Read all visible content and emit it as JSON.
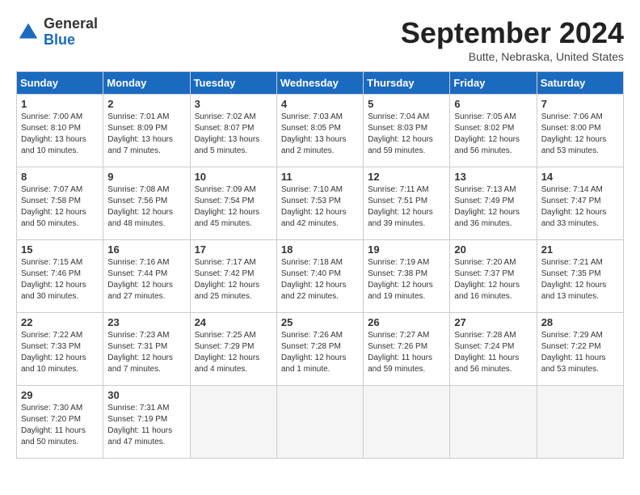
{
  "logo": {
    "general": "General",
    "blue": "Blue"
  },
  "header": {
    "month": "September 2024",
    "location": "Butte, Nebraska, United States"
  },
  "weekdays": [
    "Sunday",
    "Monday",
    "Tuesday",
    "Wednesday",
    "Thursday",
    "Friday",
    "Saturday"
  ],
  "weeks": [
    [
      {
        "day": "1",
        "sunrise": "Sunrise: 7:00 AM",
        "sunset": "Sunset: 8:10 PM",
        "daylight": "Daylight: 13 hours and 10 minutes."
      },
      {
        "day": "2",
        "sunrise": "Sunrise: 7:01 AM",
        "sunset": "Sunset: 8:09 PM",
        "daylight": "Daylight: 13 hours and 7 minutes."
      },
      {
        "day": "3",
        "sunrise": "Sunrise: 7:02 AM",
        "sunset": "Sunset: 8:07 PM",
        "daylight": "Daylight: 13 hours and 5 minutes."
      },
      {
        "day": "4",
        "sunrise": "Sunrise: 7:03 AM",
        "sunset": "Sunset: 8:05 PM",
        "daylight": "Daylight: 13 hours and 2 minutes."
      },
      {
        "day": "5",
        "sunrise": "Sunrise: 7:04 AM",
        "sunset": "Sunset: 8:03 PM",
        "daylight": "Daylight: 12 hours and 59 minutes."
      },
      {
        "day": "6",
        "sunrise": "Sunrise: 7:05 AM",
        "sunset": "Sunset: 8:02 PM",
        "daylight": "Daylight: 12 hours and 56 minutes."
      },
      {
        "day": "7",
        "sunrise": "Sunrise: 7:06 AM",
        "sunset": "Sunset: 8:00 PM",
        "daylight": "Daylight: 12 hours and 53 minutes."
      }
    ],
    [
      {
        "day": "8",
        "sunrise": "Sunrise: 7:07 AM",
        "sunset": "Sunset: 7:58 PM",
        "daylight": "Daylight: 12 hours and 50 minutes."
      },
      {
        "day": "9",
        "sunrise": "Sunrise: 7:08 AM",
        "sunset": "Sunset: 7:56 PM",
        "daylight": "Daylight: 12 hours and 48 minutes."
      },
      {
        "day": "10",
        "sunrise": "Sunrise: 7:09 AM",
        "sunset": "Sunset: 7:54 PM",
        "daylight": "Daylight: 12 hours and 45 minutes."
      },
      {
        "day": "11",
        "sunrise": "Sunrise: 7:10 AM",
        "sunset": "Sunset: 7:53 PM",
        "daylight": "Daylight: 12 hours and 42 minutes."
      },
      {
        "day": "12",
        "sunrise": "Sunrise: 7:11 AM",
        "sunset": "Sunset: 7:51 PM",
        "daylight": "Daylight: 12 hours and 39 minutes."
      },
      {
        "day": "13",
        "sunrise": "Sunrise: 7:13 AM",
        "sunset": "Sunset: 7:49 PM",
        "daylight": "Daylight: 12 hours and 36 minutes."
      },
      {
        "day": "14",
        "sunrise": "Sunrise: 7:14 AM",
        "sunset": "Sunset: 7:47 PM",
        "daylight": "Daylight: 12 hours and 33 minutes."
      }
    ],
    [
      {
        "day": "15",
        "sunrise": "Sunrise: 7:15 AM",
        "sunset": "Sunset: 7:46 PM",
        "daylight": "Daylight: 12 hours and 30 minutes."
      },
      {
        "day": "16",
        "sunrise": "Sunrise: 7:16 AM",
        "sunset": "Sunset: 7:44 PM",
        "daylight": "Daylight: 12 hours and 27 minutes."
      },
      {
        "day": "17",
        "sunrise": "Sunrise: 7:17 AM",
        "sunset": "Sunset: 7:42 PM",
        "daylight": "Daylight: 12 hours and 25 minutes."
      },
      {
        "day": "18",
        "sunrise": "Sunrise: 7:18 AM",
        "sunset": "Sunset: 7:40 PM",
        "daylight": "Daylight: 12 hours and 22 minutes."
      },
      {
        "day": "19",
        "sunrise": "Sunrise: 7:19 AM",
        "sunset": "Sunset: 7:38 PM",
        "daylight": "Daylight: 12 hours and 19 minutes."
      },
      {
        "day": "20",
        "sunrise": "Sunrise: 7:20 AM",
        "sunset": "Sunset: 7:37 PM",
        "daylight": "Daylight: 12 hours and 16 minutes."
      },
      {
        "day": "21",
        "sunrise": "Sunrise: 7:21 AM",
        "sunset": "Sunset: 7:35 PM",
        "daylight": "Daylight: 12 hours and 13 minutes."
      }
    ],
    [
      {
        "day": "22",
        "sunrise": "Sunrise: 7:22 AM",
        "sunset": "Sunset: 7:33 PM",
        "daylight": "Daylight: 12 hours and 10 minutes."
      },
      {
        "day": "23",
        "sunrise": "Sunrise: 7:23 AM",
        "sunset": "Sunset: 7:31 PM",
        "daylight": "Daylight: 12 hours and 7 minutes."
      },
      {
        "day": "24",
        "sunrise": "Sunrise: 7:25 AM",
        "sunset": "Sunset: 7:29 PM",
        "daylight": "Daylight: 12 hours and 4 minutes."
      },
      {
        "day": "25",
        "sunrise": "Sunrise: 7:26 AM",
        "sunset": "Sunset: 7:28 PM",
        "daylight": "Daylight: 12 hours and 1 minute."
      },
      {
        "day": "26",
        "sunrise": "Sunrise: 7:27 AM",
        "sunset": "Sunset: 7:26 PM",
        "daylight": "Daylight: 11 hours and 59 minutes."
      },
      {
        "day": "27",
        "sunrise": "Sunrise: 7:28 AM",
        "sunset": "Sunset: 7:24 PM",
        "daylight": "Daylight: 11 hours and 56 minutes."
      },
      {
        "day": "28",
        "sunrise": "Sunrise: 7:29 AM",
        "sunset": "Sunset: 7:22 PM",
        "daylight": "Daylight: 11 hours and 53 minutes."
      }
    ],
    [
      {
        "day": "29",
        "sunrise": "Sunrise: 7:30 AM",
        "sunset": "Sunset: 7:20 PM",
        "daylight": "Daylight: 11 hours and 50 minutes."
      },
      {
        "day": "30",
        "sunrise": "Sunrise: 7:31 AM",
        "sunset": "Sunset: 7:19 PM",
        "daylight": "Daylight: 11 hours and 47 minutes."
      },
      null,
      null,
      null,
      null,
      null
    ]
  ]
}
